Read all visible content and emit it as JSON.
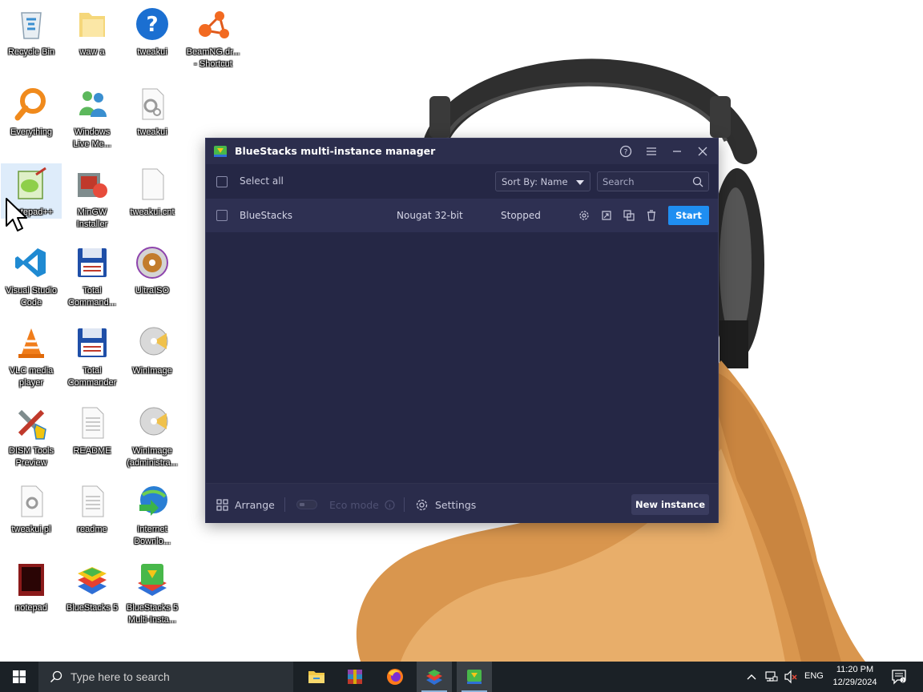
{
  "desktop": {
    "icons": [
      {
        "label": "Recycle Bin",
        "icon": "recycle-bin-icon"
      },
      {
        "label": "waw a",
        "icon": "folder-icon"
      },
      {
        "label": "tweakui",
        "icon": "help-icon"
      },
      {
        "label": "BeamNG.dr...\n- Shortcut",
        "icon": "beamng-icon"
      },
      {
        "label": "Everything",
        "icon": "everything-search-icon"
      },
      {
        "label": "Windows\nLive Me...",
        "icon": "windows-live-messenger-icon"
      },
      {
        "label": "tweakui",
        "icon": "settings-file-icon"
      },
      {
        "label": "Notepad++",
        "icon": "notepad-plus-plus-icon"
      },
      {
        "label": "MinGW\nInstaller",
        "icon": "mingw-installer-icon"
      },
      {
        "label": "tweakui.cnt",
        "icon": "blank-file-icon"
      },
      {
        "label": "Visual Studio\nCode",
        "icon": "vscode-icon"
      },
      {
        "label": "Total\nCommand...",
        "icon": "total-commander-icon"
      },
      {
        "label": "UltraISO",
        "icon": "ultraiso-icon"
      },
      {
        "label": "VLC media\nplayer",
        "icon": "vlc-icon"
      },
      {
        "label": "Total\nCommander",
        "icon": "total-commander-icon"
      },
      {
        "label": "WinImage",
        "icon": "winimage-icon"
      },
      {
        "label": "DISM Tools\nPreview",
        "icon": "dism-tools-icon"
      },
      {
        "label": "README",
        "icon": "text-file-icon"
      },
      {
        "label": "WinImage\n(administra...",
        "icon": "winimage-icon"
      },
      {
        "label": "tweakui.pl",
        "icon": "settings-file-icon"
      },
      {
        "label": "readme",
        "icon": "text-file-icon"
      },
      {
        "label": "Internet\nDownlo...",
        "icon": "internet-download-manager-icon"
      },
      {
        "label": "notepad",
        "icon": "notepad-icon"
      },
      {
        "label": "BlueStacks 5",
        "icon": "bluestacks-icon"
      },
      {
        "label": "BlueStacks 5\nMulti-Insta...",
        "icon": "bluestacks-multi-instance-icon"
      }
    ]
  },
  "window": {
    "title": "BlueStacks multi-instance manager",
    "toolbar": {
      "select_all_label": "Select all",
      "sort_label": "Sort By: Name",
      "search_placeholder": "Search"
    },
    "instances": [
      {
        "name": "BlueStacks",
        "version": "Nougat 32-bit",
        "status": "Stopped",
        "action_label": "Start"
      }
    ],
    "footer": {
      "arrange_label": "Arrange",
      "eco_mode_label": "Eco mode",
      "settings_label": "Settings",
      "new_instance_label": "New instance"
    },
    "colors": {
      "background": "#252745",
      "start_button": "#1f8ef1"
    }
  },
  "taskbar": {
    "search_placeholder": "Type here to search",
    "apps": [
      "file-explorer-icon",
      "winrar-icon",
      "firefox-icon",
      "bluestacks-icon",
      "bluestacks-multi-instance-icon"
    ],
    "language": "ENG",
    "time": "11:20 PM",
    "date": "12/29/2024"
  }
}
